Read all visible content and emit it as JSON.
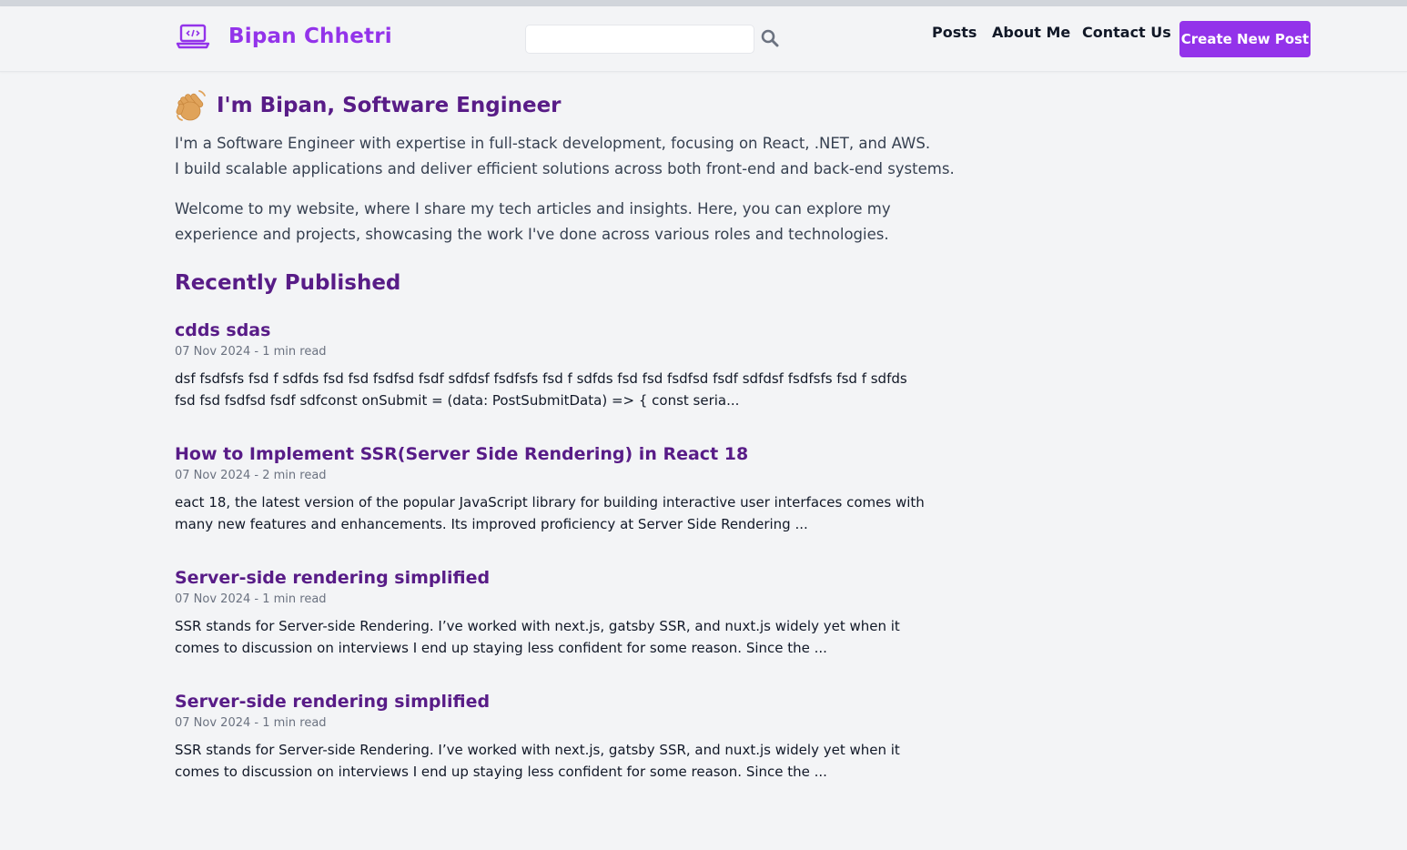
{
  "header": {
    "brand_name": "Bipan Chhetri",
    "brand_icon": "laptop-code-icon",
    "search": {
      "placeholder": "",
      "value": "",
      "icon": "search-icon"
    },
    "nav": {
      "posts": "Posts",
      "about": "About Me",
      "contact": "Contact Us"
    },
    "create_button": "Create New Post"
  },
  "hero": {
    "icon": "waving-hand-icon",
    "title": "I'm Bipan, Software Engineer",
    "intro_line1": "I'm a Software Engineer with expertise in full-stack development, focusing on React, .NET, and AWS.",
    "intro_line2": "I build scalable applications and deliver efficient solutions across both front-end and back-end systems.",
    "welcome": "Welcome to my website, where I share my tech articles and insights. Here, you can explore my experience and projects, showcasing the work I've done across various roles and technologies."
  },
  "recent": {
    "heading": "Recently Published",
    "posts": [
      {
        "title": "cdds sdas",
        "meta": "07 Nov 2024 - 1 min read",
        "excerpt": "dsf fsdfsfs fsd f sdfds fsd fsd fsdfsd fsdf sdfdsf fsdfsfs fsd f sdfds fsd fsd fsdfsd fsdf sdfdsf fsdfsfs fsd f sdfds fsd fsd fsdfsd fsdf sdfconst onSubmit = (data: PostSubmitData) => { const seria..."
      },
      {
        "title": "How to Implement SSR(Server Side Rendering) in React 18",
        "meta": "07 Nov 2024 - 2 min read",
        "excerpt": "eact 18, the latest version of the popular JavaScript library for building interactive user interfaces comes with many new features and enhancements. Its improved proficiency at Server Side Rendering ..."
      },
      {
        "title": "Server-side rendering simplified",
        "meta": "07 Nov 2024 - 1 min read",
        "excerpt": "SSR stands for Server-side Rendering. I’ve worked with next.js, gatsby SSR, and nuxt.js widely yet when it comes to discussion on interviews I end up staying less confident for some reason. Since the ..."
      },
      {
        "title": "Server-side rendering simplified",
        "meta": "07 Nov 2024 - 1 min read",
        "excerpt": "SSR stands for Server-side Rendering. I’ve worked with next.js, gatsby SSR, and nuxt.js widely yet when it comes to discussion on interviews I end up staying less confident for some reason. Since the ..."
      }
    ]
  },
  "colors": {
    "accent": "#9333ea",
    "heading": "#581c87",
    "background": "#f3f4f6",
    "wave": "#e0a35a"
  }
}
